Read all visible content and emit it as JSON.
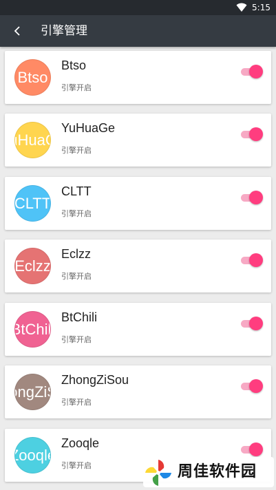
{
  "status_bar": {
    "time": "5:15",
    "wifi_icon": "wifi-icon"
  },
  "app_bar": {
    "back_icon": "chevron-left-icon",
    "title": "引擎管理"
  },
  "engines": [
    {
      "name": "Btso",
      "avatar_text": "Btso",
      "avatar_color": "#ff8a65",
      "status": "引擎开启",
      "enabled": true
    },
    {
      "name": "YuHuaGe",
      "avatar_text": "YuHuaGe",
      "avatar_color": "#ffd54f",
      "status": "引擎开启",
      "enabled": true
    },
    {
      "name": "CLTT",
      "avatar_text": "CLTT",
      "avatar_color": "#4fc3f7",
      "status": "引擎开启",
      "enabled": true
    },
    {
      "name": "Eclzz",
      "avatar_text": "Eclzz",
      "avatar_color": "#e57373",
      "status": "引擎开启",
      "enabled": true
    },
    {
      "name": "BtChili",
      "avatar_text": "BtChili",
      "avatar_color": "#f06292",
      "status": "引擎开启",
      "enabled": true
    },
    {
      "name": "ZhongZiSou",
      "avatar_text": "ZhongZiSou",
      "avatar_color": "#a1887f",
      "status": "引擎开启",
      "enabled": true
    },
    {
      "name": "Zooqle",
      "avatar_text": "Zooqle",
      "avatar_color": "#4dd0e1",
      "status": "引擎开启",
      "enabled": true
    }
  ],
  "watermark": {
    "text": "周佳软件园",
    "logo_icon": "pinwheel-logo-icon"
  }
}
